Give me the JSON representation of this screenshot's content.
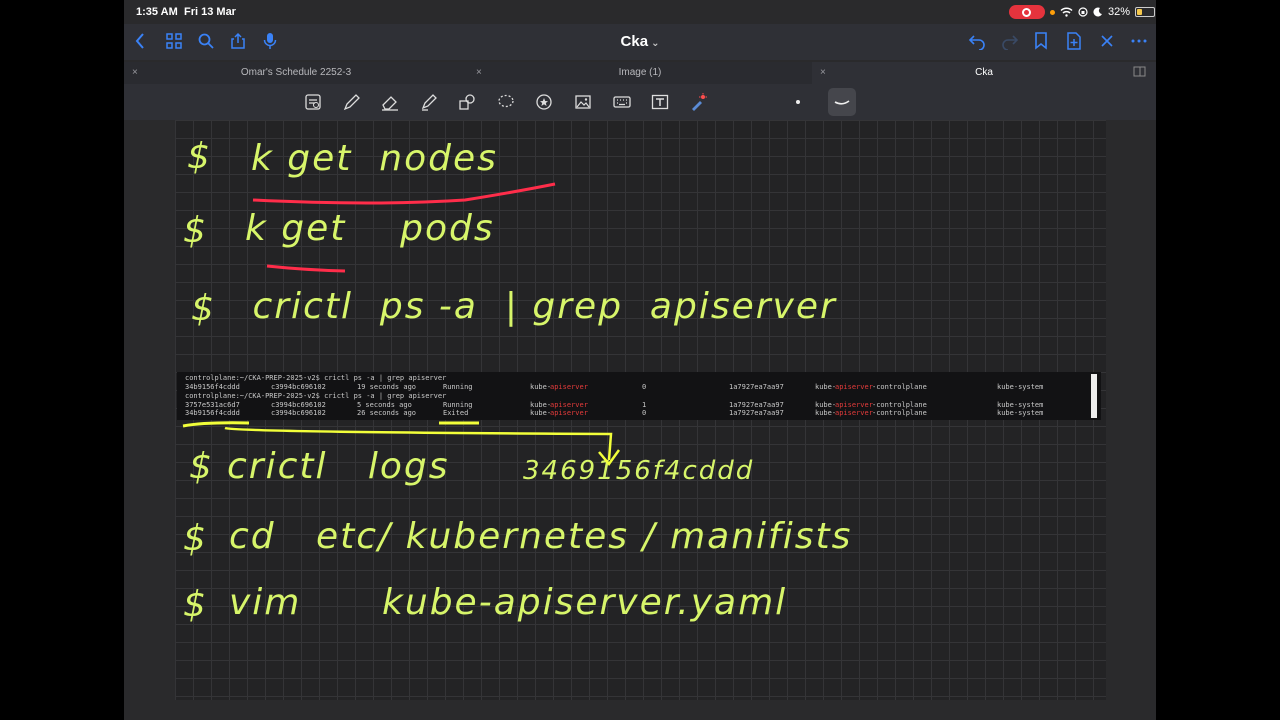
{
  "status": {
    "time": "1:35 AM",
    "date": "Fri 13 Mar",
    "battery": "32%",
    "battery_level": 0.32
  },
  "nav": {
    "title": "Cka",
    "title_chevron": "⌄"
  },
  "tabs": [
    {
      "label": "Omar's Schedule 2252-3",
      "close": "×"
    },
    {
      "label": "Image (1)",
      "close": "×"
    },
    {
      "label": "Cka",
      "close": "×",
      "active": true
    }
  ],
  "note": {
    "line1_prompt": "$",
    "line1_text": "k get  nodes",
    "line2_prompt": "$",
    "line2_text": "k get    pods",
    "line3_prompt": "$",
    "line3_text": " crictl  ps -a  | grep  apiserver",
    "line4_prompt": "$",
    "line4_text": "crictl   logs",
    "line4_id": "3469156f4cddd",
    "line5_prompt": "$",
    "line5_text": "cd   etc/ kubernetes / manifists",
    "line6_prompt": "$",
    "line6_text": "vim      kube-apiserver.yaml"
  },
  "terminal": {
    "cmd1": "controlplane:~/CKA-PREP-2025-v2$ crictl ps -a | grep apiserver",
    "cmd2": "controlplane:~/CKA-PREP-2025-v2$ crictl ps -a | grep apiserver",
    "rows": [
      {
        "id": "34b9156f4cddd",
        "image": "c3994bc696102",
        "created": "19 seconds ago",
        "state": "Running",
        "name_pre": "kube-",
        "name_red": "apiserver",
        "attempt": "0",
        "pod_id": "1a7927ea7aa97",
        "pod_pre": "kube-",
        "pod_red": "apiserver",
        "pod_post": "-controlplane",
        "ns": "kube-system"
      },
      {
        "id": "3757e531ac6d7",
        "image": "c3994bc696102",
        "created": "5 seconds ago",
        "state": "Running",
        "name_pre": "kube-",
        "name_red": "apiserver",
        "attempt": "1",
        "pod_id": "1a7927ea7aa97",
        "pod_pre": "kube-",
        "pod_red": "apiserver",
        "pod_post": "-controlplane",
        "ns": "kube-system"
      },
      {
        "id": "34b9156f4cddd",
        "image": "c3994bc696102",
        "created": "26 seconds ago",
        "state": "Exited",
        "name_pre": "kube-",
        "name_red": "apiserver",
        "attempt": "0",
        "pod_id": "1a7927ea7aa97",
        "pod_pre": "kube-",
        "pod_red": "apiserver",
        "pod_post": "-controlplane",
        "ns": "kube-system"
      }
    ]
  },
  "colors": {
    "ink": "#d7f56a",
    "accent": "#3a82f7",
    "highlight_red": "#ff2d4a",
    "highlight_yellow": "#f2ff3a"
  },
  "icons": [
    "back-icon",
    "grid-icon",
    "search-icon",
    "share-icon",
    "microphone-icon",
    "undo-icon",
    "redo-icon",
    "bookmark-icon",
    "add-page-icon",
    "close-icon",
    "more-icon"
  ]
}
